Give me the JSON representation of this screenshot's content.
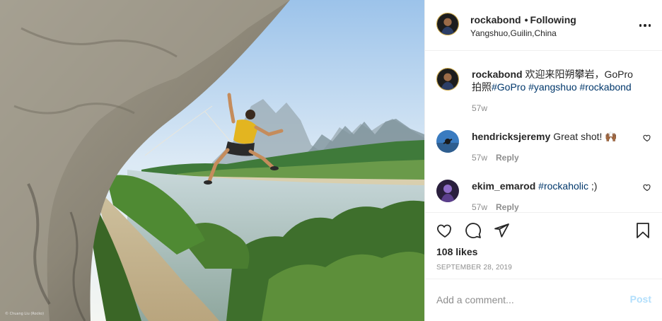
{
  "post": {
    "credit": "© Chuang Liu (Rocko)"
  },
  "header": {
    "username": "rockabond",
    "separator": "•",
    "follow_label": "Following",
    "location": "Yangshuo,Guilin,China",
    "more_icon": "more-horizontal-icon"
  },
  "caption": {
    "username": "rockabond",
    "text": "欢迎来阳朔攀岩，GoPro拍照",
    "tags": [
      "#GoPro",
      "#yangshuo",
      "#rockabond"
    ],
    "age": "57w"
  },
  "comments": [
    {
      "username": "hendricksjeremy",
      "text": "Great shot! 🙌🏾",
      "age": "57w",
      "reply_label": "Reply"
    },
    {
      "username": "ekim_emarod",
      "tag": "#rockaholic",
      "text": " ;)",
      "age": "57w",
      "reply_label": "Reply"
    }
  ],
  "actions": {
    "icons": [
      "heart-icon",
      "comment-icon",
      "share-icon",
      "bookmark-icon"
    ],
    "likes": "108 likes",
    "date": "SEPTEMBER 28, 2019"
  },
  "composer": {
    "placeholder": "Add a comment...",
    "post_label": "Post"
  },
  "colors": {
    "link": "#00376b",
    "muted": "#8e8e8e",
    "post_disabled": "#b2dffc",
    "border": "#efefef"
  }
}
